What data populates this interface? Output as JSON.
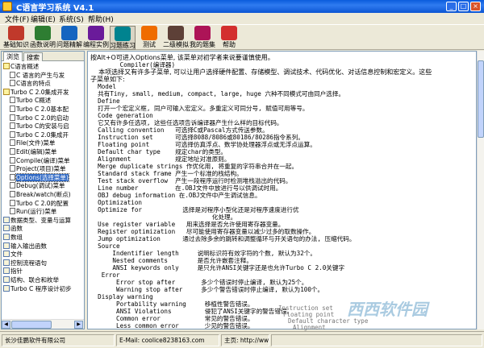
{
  "window": {
    "title": "C语言学习系统 V4.1",
    "min": "_",
    "max": "□",
    "close": "×"
  },
  "menu": [
    "文件(F)",
    "编辑(E)",
    "系统(S)",
    "帮助(H)"
  ],
  "toolbar": [
    {
      "label": "基础知识",
      "color": "#c0392b"
    },
    {
      "label": "函数说明",
      "color": "#2e7d32"
    },
    {
      "label": "问题精解",
      "color": "#1565c0"
    },
    {
      "label": "编程实例",
      "color": "#6a1b9a"
    },
    {
      "label": "习题练习",
      "color": "#00838f"
    },
    {
      "label": "测试",
      "color": "#ef6c00"
    },
    {
      "label": "二级模拟",
      "color": "#5d4037"
    },
    {
      "label": "我的题集",
      "color": "#ad1457"
    },
    {
      "label": "帮助",
      "color": "#d32f2f"
    }
  ],
  "tabs": [
    "浏览",
    "搜索"
  ],
  "tree": [
    {
      "text": "C语言概述",
      "indent": 0,
      "kind": "open"
    },
    {
      "text": "C 语言的产生与发",
      "indent": 1,
      "kind": "page"
    },
    {
      "text": "C语言的特点",
      "indent": 1,
      "kind": "page"
    },
    {
      "text": "Turbo C 2.0集成开发",
      "indent": 0,
      "kind": "open"
    },
    {
      "text": "Turbo C概述",
      "indent": 1,
      "kind": "page"
    },
    {
      "text": "Turbo C 2.0基本配",
      "indent": 1,
      "kind": "page"
    },
    {
      "text": "Turbo C 2.0的启动",
      "indent": 1,
      "kind": "page"
    },
    {
      "text": "Turbo C的安装与启",
      "indent": 1,
      "kind": "page"
    },
    {
      "text": "Turbo C 2.0集成开",
      "indent": 1,
      "kind": "page"
    },
    {
      "text": "File(文件)菜单",
      "indent": 1,
      "kind": "page"
    },
    {
      "text": "Edit(编辑)菜单",
      "indent": 1,
      "kind": "page"
    },
    {
      "text": "Compile(编译)菜单",
      "indent": 1,
      "kind": "page"
    },
    {
      "text": "Project(项目)菜单",
      "indent": 1,
      "kind": "page"
    },
    {
      "text": "Options(选择菜单)",
      "indent": 1,
      "kind": "page",
      "selected": true
    },
    {
      "text": "Debug(调试)菜单",
      "indent": 1,
      "kind": "page"
    },
    {
      "text": "Break/watch(断点)",
      "indent": 1,
      "kind": "page"
    },
    {
      "text": "Turbo C 2.0的配置",
      "indent": 1,
      "kind": "page"
    },
    {
      "text": "Run(运行)菜单",
      "indent": 1,
      "kind": "page"
    },
    {
      "text": "数据类型、变量与运算",
      "indent": 0,
      "kind": "closed"
    },
    {
      "text": "函数",
      "indent": 0,
      "kind": "closed"
    },
    {
      "text": "数组",
      "indent": 0,
      "kind": "closed"
    },
    {
      "text": "输入输出函数",
      "indent": 0,
      "kind": "closed"
    },
    {
      "text": "文件",
      "indent": 0,
      "kind": "closed"
    },
    {
      "text": "控制流程语句",
      "indent": 0,
      "kind": "closed"
    },
    {
      "text": "指针",
      "indent": 0,
      "kind": "closed"
    },
    {
      "text": "结构、联合和枚举",
      "indent": 0,
      "kind": "closed"
    },
    {
      "text": "Turbo C 程序设计初步",
      "indent": 0,
      "kind": "closed"
    }
  ],
  "content": [
    {
      "t": "按Alt+O可进入Options菜单, 该菜单对初学者来说要谨慎使用。",
      "mono": false
    },
    {
      "t": "        Compiler(编译器)",
      "mono": true
    },
    {
      "t": "    本项选择又有许多子菜单, 可以让用户选择硬件配置、存储模型、调试技术、代码优化、对话信息控制和宏定义。这些",
      "mono": false
    },
    {
      "t": "子菜单如下:",
      "mono": false
    },
    {
      "t": "  Model",
      "mono": true
    },
    {
      "t": "  共有Tiny, small, medium, compact, large, huge 六种不同模式可由同户选择。",
      "mono": true
    },
    {
      "t": "  Define",
      "mono": true
    },
    {
      "t": "  打开一个宏定义框, 同户可输入宏定义。多重定义可同分号, 赋值可用等号。",
      "mono": true
    },
    {
      "t": "  Code generation",
      "mono": true
    },
    {
      "t": "  它又有许多任选项, 这些任选项告诉编译器产生什么样的目标代码。",
      "mono": true
    },
    {
      "t": "  Calling convention   可选择C或Pascal方式传送参数。",
      "mono": true
    },
    {
      "t": "  Instruction set      可选择8088/8086或80186/80286指令系列。",
      "mono": true
    },
    {
      "t": "  Floating point       可选择仿真浮点、数学协处理器浮点或无浮点运算。",
      "mono": true
    },
    {
      "t": "  Default char type    规定char的类型。",
      "mono": true
    },
    {
      "t": "  Alignment            规定地址对准原则。",
      "mono": true
    },
    {
      "t": "  Merge duplicate strings 作优化用, 将重复的字符串合并在一起。",
      "mono": true
    },
    {
      "t": "  Standard stack frame 产生一个标准的栈结构。",
      "mono": true
    },
    {
      "t": "  Test stack overflow  产生一段程序运行时检测堆栈溢出的代码。",
      "mono": true
    },
    {
      "t": "  Line number          在.OBJ文件中放进行号以供调试时用。",
      "mono": true
    },
    {
      "t": "  OBJ debug information 在.OBJ文件中产生调试信息。",
      "mono": true
    },
    {
      "t": "  Optimization",
      "mono": true
    },
    {
      "t": "  Optimize for           选择是对程序小型化还是对程序速度进行优",
      "mono": true
    },
    {
      "t": "                                 化处理。",
      "mono": true
    },
    {
      "t": "  Use register variable   用来选择是否允许使用寄存器变量。",
      "mono": true
    },
    {
      "t": "  Register optimization   尽可能使用寄存器变量以减少过多的取数操作。",
      "mono": true
    },
    {
      "t": "  Jump optimization      通过去除多余的跳转和调整循环与开关语句的办法, 压缩代码。",
      "mono": true
    },
    {
      "t": "  Source",
      "mono": true
    },
    {
      "t": "      Indentifier length     说明标识符有效字符的个数, 默认为32个。",
      "mono": true
    },
    {
      "t": "      Nested comments        是否允许嵌套注释。",
      "mono": true
    },
    {
      "t": "      ANSI keywords only     是只允许ANSI关键字还是也允许Turbo C 2.0关键字",
      "mono": true
    },
    {
      "t": "   Error",
      "mono": true
    },
    {
      "t": "       Error stop after       多少个错误时停止编译, 默认为25个。",
      "mono": true
    },
    {
      "t": "       Warning stop after     多少个警告错误时停止编译, 默认为100个。",
      "mono": true
    },
    {
      "t": "  Display warning",
      "mono": true
    },
    {
      "t": "       Portability warning     移植性警告错误。",
      "mono": true
    },
    {
      "t": "       ANSI Violations         侵犯了ANSI关键字的警告错误。",
      "mono": true
    },
    {
      "t": "       Common error            常见的警告错误。",
      "mono": true
    },
    {
      "t": "       Less common error       少见的警告错误。",
      "mono": true
    }
  ],
  "status": {
    "company": "长沙佳鹏软件有限公司",
    "email": "E-Mail: coolice8238163.com",
    "homepage": "主页: http://www."
  },
  "ghost_lines": [
    "Instruction set",
    "Floating point",
    "Default character type",
    "Alignment"
  ]
}
